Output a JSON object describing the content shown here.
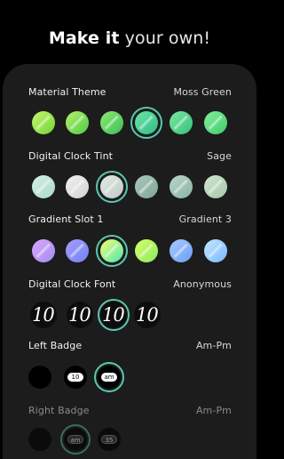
{
  "headline": {
    "bold": "Make it",
    "light": " your own!"
  },
  "material_theme": {
    "label": "Material Theme",
    "value": "Moss Green",
    "swatches": [
      {
        "colors": [
          "#c8f56a",
          "#6fd63a"
        ],
        "selected": false
      },
      {
        "colors": [
          "#b6f06a",
          "#4fcc4a"
        ],
        "selected": false
      },
      {
        "colors": [
          "#8ee870",
          "#3cbf5a"
        ],
        "selected": false
      },
      {
        "colors": [
          "#6de2a6",
          "#2fbf88"
        ],
        "selected": true
      },
      {
        "colors": [
          "#7ae8a0",
          "#36c27c"
        ],
        "selected": false
      },
      {
        "colors": [
          "#86ee9a",
          "#3ecc6c"
        ],
        "selected": false
      }
    ]
  },
  "clock_tint": {
    "label": "Digital Clock Tint",
    "value": "Sage",
    "swatches": [
      {
        "colors": [
          "#d6efe6",
          "#a8d9c8"
        ],
        "selected": false
      },
      {
        "colors": [
          "#f0f0f0",
          "#d2d2d2"
        ],
        "selected": false
      },
      {
        "colors": [
          "#e4ece8",
          "#bccac4"
        ],
        "selected": true
      },
      {
        "colors": [
          "#aac8bc",
          "#7fa596"
        ],
        "selected": false
      },
      {
        "colors": [
          "#b8d6c8",
          "#8ab4a2"
        ],
        "selected": false
      },
      {
        "colors": [
          "#cfe6d2",
          "#a3c8a8"
        ],
        "selected": false
      }
    ]
  },
  "gradient_slot": {
    "label": "Gradient Slot 1",
    "value": "Gradient 3",
    "swatches": [
      {
        "colors": [
          "#d9a8ff",
          "#a58bf0"
        ],
        "selected": false
      },
      {
        "colors": [
          "#a89aff",
          "#6f86ef"
        ],
        "selected": false
      },
      {
        "colors": [
          "#f5ff6a",
          "#4de5b6"
        ],
        "selected": true
      },
      {
        "colors": [
          "#d6ff6a",
          "#8ee860"
        ],
        "selected": false
      },
      {
        "colors": [
          "#a8c8ff",
          "#6aa0f5"
        ],
        "selected": false
      },
      {
        "colors": [
          "#c2e8ff",
          "#7ab8ff"
        ],
        "selected": false
      }
    ]
  },
  "clock_font": {
    "label": "Digital Clock Font",
    "value": "Anonymous",
    "samples": [
      {
        "text": "10",
        "selected": false
      },
      {
        "text": "10",
        "selected": false
      },
      {
        "text": "10",
        "selected": true
      },
      {
        "text": "10",
        "selected": false
      }
    ]
  },
  "left_badge": {
    "label": "Left Badge",
    "value": "Am-Pm",
    "options": [
      {
        "text": "",
        "selected": false
      },
      {
        "text": "10",
        "selected": false
      },
      {
        "text": "am",
        "selected": true
      }
    ]
  },
  "right_badge": {
    "label": "Right Badge",
    "value": "Am-Pm",
    "options": [
      {
        "text": "",
        "selected": false
      },
      {
        "text": "am",
        "selected": true
      },
      {
        "text": "35",
        "selected": false
      }
    ]
  }
}
